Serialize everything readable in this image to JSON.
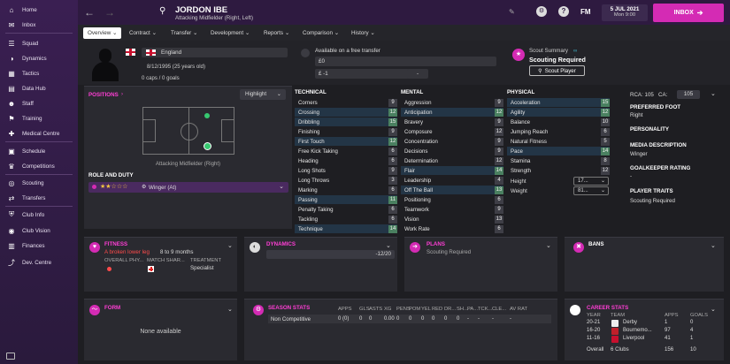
{
  "sidebar": {
    "items": [
      {
        "label": "Home",
        "icon": "home-icon"
      },
      {
        "label": "Inbox",
        "icon": "inbox-icon"
      },
      {
        "label": "Squad",
        "icon": "squad-icon"
      },
      {
        "label": "Dynamics",
        "icon": "dynamics-icon"
      },
      {
        "label": "Tactics",
        "icon": "tactics-icon"
      },
      {
        "label": "Data Hub",
        "icon": "data-hub-icon"
      },
      {
        "label": "Staff",
        "icon": "staff-icon"
      },
      {
        "label": "Training",
        "icon": "training-icon"
      },
      {
        "label": "Medical Centre",
        "icon": "medical-icon"
      },
      {
        "label": "Schedule",
        "icon": "schedule-icon"
      },
      {
        "label": "Competitions",
        "icon": "trophy-icon"
      },
      {
        "label": "Scouting",
        "icon": "scouting-icon"
      },
      {
        "label": "Transfers",
        "icon": "transfers-icon"
      },
      {
        "label": "Club Info",
        "icon": "shield-icon"
      },
      {
        "label": "Club Vision",
        "icon": "vision-icon"
      },
      {
        "label": "Finances",
        "icon": "finances-icon"
      },
      {
        "label": "Dev. Centre",
        "icon": "dev-centre-icon"
      }
    ]
  },
  "header": {
    "player_name": "JORDON IBE",
    "subtitle": "Attacking Midfielder (Right, Left)",
    "fm_label": "FM",
    "date": "5 JUL 2021",
    "day": "Mon 9:00",
    "inbox_label": "INBOX"
  },
  "tabs": [
    "Overview",
    "Contract",
    "Transfer",
    "Development",
    "Reports",
    "Comparison",
    "History"
  ],
  "profile": {
    "nationality": "England",
    "dob": "8/12/1995 (25 years old)",
    "caps": "0 caps / 0 goals"
  },
  "transfer": {
    "status": "Available on a free transfer",
    "value1": "£0",
    "value2": "£ -1",
    "dash": "-"
  },
  "scout": {
    "title": "Scout Summary",
    "status": "Scouting Required",
    "button": "Scout Player"
  },
  "positions": {
    "label": "POSITIONS",
    "highlight": "Highlight",
    "position_name": "Attacking Midfielder (Right)"
  },
  "role": {
    "label": "ROLE AND DUTY",
    "value": "Winger (At)",
    "stars": "★★☆☆☆"
  },
  "technical": {
    "title": "TECHNICAL",
    "rows": [
      {
        "n": "Corners",
        "v": "9",
        "hl": false
      },
      {
        "n": "Crossing",
        "v": "12",
        "hl": true
      },
      {
        "n": "Dribbling",
        "v": "15",
        "hl": true
      },
      {
        "n": "Finishing",
        "v": "9",
        "hl": false
      },
      {
        "n": "First Touch",
        "v": "12",
        "hl": true
      },
      {
        "n": "Free Kick Taking",
        "v": "6",
        "hl": false
      },
      {
        "n": "Heading",
        "v": "6",
        "hl": false
      },
      {
        "n": "Long Shots",
        "v": "9",
        "hl": false
      },
      {
        "n": "Long Throws",
        "v": "3",
        "hl": false
      },
      {
        "n": "Marking",
        "v": "6",
        "hl": false
      },
      {
        "n": "Passing",
        "v": "11",
        "hl": true
      },
      {
        "n": "Penalty Taking",
        "v": "6",
        "hl": false
      },
      {
        "n": "Tackling",
        "v": "6",
        "hl": false
      },
      {
        "n": "Technique",
        "v": "14",
        "hl": true
      }
    ]
  },
  "mental": {
    "title": "MENTAL",
    "rows": [
      {
        "n": "Aggression",
        "v": "9",
        "hl": false
      },
      {
        "n": "Anticipation",
        "v": "12",
        "hl": true
      },
      {
        "n": "Bravery",
        "v": "9",
        "hl": false
      },
      {
        "n": "Composure",
        "v": "12",
        "hl": false
      },
      {
        "n": "Concentration",
        "v": "9",
        "hl": false
      },
      {
        "n": "Decisions",
        "v": "9",
        "hl": false
      },
      {
        "n": "Determination",
        "v": "12",
        "hl": false
      },
      {
        "n": "Flair",
        "v": "14",
        "hl": true
      },
      {
        "n": "Leadership",
        "v": "4",
        "hl": false
      },
      {
        "n": "Off The Ball",
        "v": "13",
        "hl": true
      },
      {
        "n": "Positioning",
        "v": "6",
        "hl": false
      },
      {
        "n": "Teamwork",
        "v": "9",
        "hl": false
      },
      {
        "n": "Vision",
        "v": "13",
        "hl": false
      },
      {
        "n": "Work Rate",
        "v": "6",
        "hl": false
      }
    ]
  },
  "physical": {
    "title": "PHYSICAL",
    "rows": [
      {
        "n": "Acceleration",
        "v": "15",
        "hl": true
      },
      {
        "n": "Agility",
        "v": "12",
        "hl": true
      },
      {
        "n": "Balance",
        "v": "10",
        "hl": false
      },
      {
        "n": "Jumping Reach",
        "v": "6",
        "hl": false
      },
      {
        "n": "Natural Fitness",
        "v": "5",
        "hl": false
      },
      {
        "n": "Pace",
        "v": "14",
        "hl": true
      },
      {
        "n": "Stamina",
        "v": "8",
        "hl": false
      },
      {
        "n": "Strength",
        "v": "12",
        "hl": false
      }
    ],
    "height_label": "Height",
    "height_value": "17...",
    "weight_label": "Weight",
    "weight_value": "81..."
  },
  "info": {
    "rca": "RCA: 105",
    "ca_label": "CA:",
    "ca_value": "105",
    "foot_title": "PREFERRED FOOT",
    "foot_value": "Right",
    "personality_title": "PERSONALITY",
    "media_title": "MEDIA DESCRIPTION",
    "media_value": "Winger",
    "gk_title": "GOALKEEPER RATING",
    "gk_value": "-",
    "traits_title": "PLAYER TRAITS",
    "traits_value": "Scouting Required"
  },
  "fitness": {
    "title": "FITNESS",
    "injury": "A broken lower leg",
    "duration": "8 to 9 months",
    "col1": "OVERALL PHY...",
    "col2": "MATCH SHAR...",
    "col3": "TREATMENT",
    "treatment": "Specialist"
  },
  "dynamics": {
    "title": "DYNAMICS",
    "value": "-12/20"
  },
  "plans": {
    "title": "PLANS",
    "value": "Scouting Required"
  },
  "bans": {
    "title": "BANS"
  },
  "form": {
    "title": "FORM",
    "value": "None available"
  },
  "season_stats": {
    "title": "SEASON STATS",
    "headers": [
      "APPS",
      "GLS",
      "ASTS",
      "XG",
      "PENS",
      "POM",
      "YEL",
      "RED",
      "DR...",
      "SH...",
      "PA...",
      "TCK...",
      "CLE...",
      "AV RAT"
    ],
    "row_label": "Non Competitive",
    "values": [
      "0 (0)",
      "0",
      "0",
      "0.00",
      "0",
      "0",
      "0",
      "0",
      "0",
      "0",
      "-",
      "-",
      "-",
      "-"
    ]
  },
  "career_stats": {
    "title": "CAREER STATS",
    "headers": [
      "YEAR",
      "TEAM",
      "APPS",
      "GOALS"
    ],
    "rows": [
      {
        "year": "20-21",
        "team": "Derby",
        "apps": "1",
        "goals": "0"
      },
      {
        "year": "16-20",
        "team": "Bournemo...",
        "apps": "97",
        "goals": "4"
      },
      {
        "year": "11-16",
        "team": "Liverpool",
        "apps": "41",
        "goals": "1"
      }
    ],
    "overall_label": "Overall",
    "overall_team": "6 Clubs",
    "overall_apps": "156",
    "overall_goals": "10"
  }
}
